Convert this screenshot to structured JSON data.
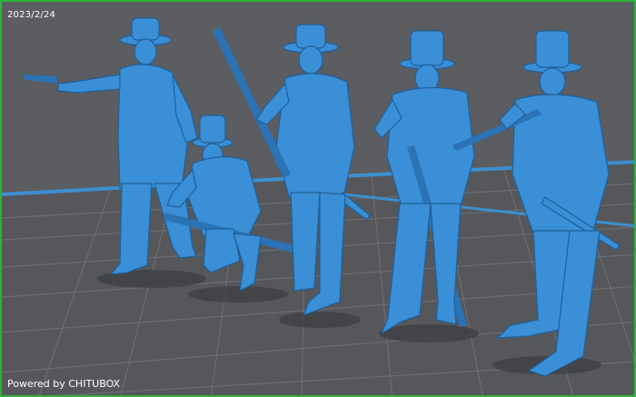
{
  "viewer": {
    "date_stamp": "2023/2/24",
    "powered_by": "Powered by CHITUBOX",
    "colors": {
      "frame_border": "#2db33a",
      "background": "#5b5d60",
      "grid_line": "#6c6e71",
      "grid_cell": "#4e5053",
      "platform_edge": "#3c8fd0",
      "model": "#3a8fd6"
    }
  },
  "models": [
    {
      "id": "soldier-pointing-pistol"
    },
    {
      "id": "soldier-kneeling-with-rifle"
    },
    {
      "id": "soldier-holding-rifle-upright"
    },
    {
      "id": "soldier-loading-rifle"
    },
    {
      "id": "soldier-aiming-rifle"
    }
  ]
}
